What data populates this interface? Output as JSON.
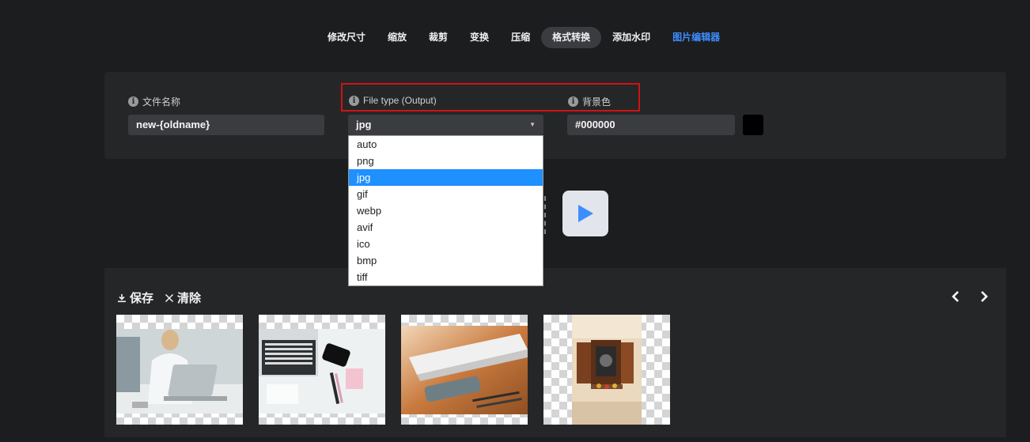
{
  "nav": {
    "tabs": [
      {
        "label": "修改尺寸"
      },
      {
        "label": "缩放"
      },
      {
        "label": "裁剪"
      },
      {
        "label": "变换"
      },
      {
        "label": "压缩"
      },
      {
        "label": "格式转换",
        "active": true
      },
      {
        "label": "添加水印"
      },
      {
        "label": "图片编辑器",
        "color": "#3d8dff"
      }
    ]
  },
  "settings": {
    "filename_label": "文件名称",
    "filename_value": "new-{oldname}",
    "filetype_label": "File type (Output)",
    "filetype_value": "jpg",
    "bgcolor_label": "背景色",
    "bgcolor_value": "#000000"
  },
  "dropdown": {
    "options": [
      "auto",
      "png",
      "jpg",
      "gif",
      "webp",
      "avif",
      "ico",
      "bmp",
      "tiff"
    ],
    "selected": "jpg",
    "selected_color": "#1e90ff"
  },
  "run": {
    "icon": "play-icon",
    "color": "#3d8dff"
  },
  "output": {
    "save_label": "保存",
    "clear_label": "清除",
    "thumbnails": [
      {
        "icon": "image-thumbnail"
      },
      {
        "icon": "image-thumbnail"
      },
      {
        "icon": "image-thumbnail"
      },
      {
        "icon": "image-thumbnail"
      }
    ]
  },
  "colors": {
    "highlight_border": "#d11212",
    "background": "#1c1d1f",
    "panel": "#252628"
  }
}
